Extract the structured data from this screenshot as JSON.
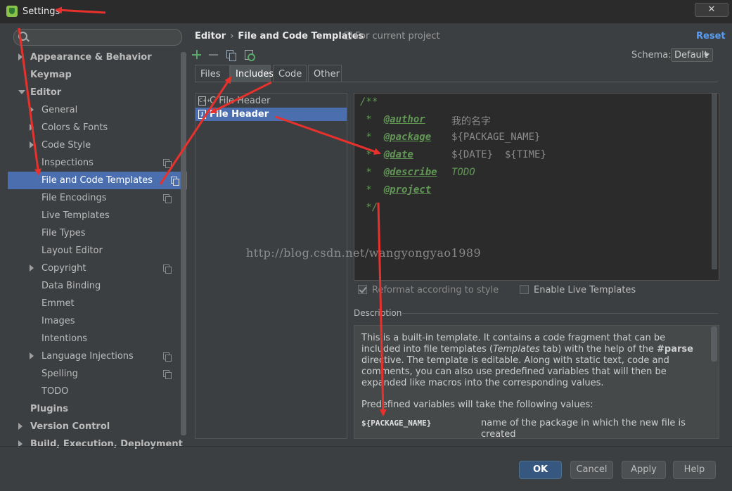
{
  "window": {
    "title": "Settings",
    "close_label": "✕"
  },
  "sidebar": {
    "search_placeholder": "",
    "items": [
      {
        "label": "Appearance & Behavior",
        "level": 0,
        "bold": true,
        "arrow": "right"
      },
      {
        "label": "Keymap",
        "level": 0,
        "bold": true
      },
      {
        "label": "Editor",
        "level": 0,
        "bold": true,
        "arrow": "down"
      },
      {
        "label": "General",
        "level": 1,
        "arrow": "right"
      },
      {
        "label": "Colors & Fonts",
        "level": 1,
        "arrow": "right"
      },
      {
        "label": "Code Style",
        "level": 1,
        "arrow": "right"
      },
      {
        "label": "Inspections",
        "level": 1,
        "copy": true
      },
      {
        "label": "File and Code Templates",
        "level": 1,
        "copy": true,
        "selected": true
      },
      {
        "label": "File Encodings",
        "level": 1,
        "copy": true
      },
      {
        "label": "Live Templates",
        "level": 1
      },
      {
        "label": "File Types",
        "level": 1
      },
      {
        "label": "Layout Editor",
        "level": 1
      },
      {
        "label": "Copyright",
        "level": 1,
        "arrow": "right",
        "copy": true
      },
      {
        "label": "Data Binding",
        "level": 1
      },
      {
        "label": "Emmet",
        "level": 1
      },
      {
        "label": "Images",
        "level": 1
      },
      {
        "label": "Intentions",
        "level": 1
      },
      {
        "label": "Language Injections",
        "level": 1,
        "arrow": "right",
        "copy": true
      },
      {
        "label": "Spelling",
        "level": 1,
        "copy": true
      },
      {
        "label": "TODO",
        "level": 1
      },
      {
        "label": "Plugins",
        "level": 0,
        "bold": true
      },
      {
        "label": "Version Control",
        "level": 0,
        "bold": true,
        "arrow": "right"
      },
      {
        "label": "Build, Execution, Deployment",
        "level": 0,
        "bold": true,
        "arrow": "right"
      }
    ]
  },
  "header": {
    "crumb_parent": "Editor",
    "crumb_sep": "›",
    "crumb_current": "File and Code Templates",
    "scope": "For current project",
    "reset_label": "Reset",
    "schema_label": "Schema:",
    "schema_value": "Default"
  },
  "tabs": [
    {
      "label": "Files",
      "active": false
    },
    {
      "label": "Includes",
      "active": true
    },
    {
      "label": "Code",
      "active": false
    },
    {
      "label": "Other",
      "active": false
    }
  ],
  "templates": [
    {
      "label": "C File Header",
      "icon": "C++",
      "selected": false
    },
    {
      "label": "File Header",
      "icon": "J",
      "selected": true
    }
  ],
  "editor": {
    "lines": [
      {
        "prefix": "/**",
        "tag": "",
        "value": ""
      },
      {
        "prefix": " *  ",
        "tag": "@author",
        "value": "我的名字"
      },
      {
        "prefix": " *  ",
        "tag": "@package",
        "value": "${PACKAGE_NAME}"
      },
      {
        "prefix": " *  ",
        "tag": "@date",
        "value": "${DATE}  ${TIME}"
      },
      {
        "prefix": " *  ",
        "tag": "@describe",
        "value": "TODO",
        "todo": true
      },
      {
        "prefix": " *  ",
        "tag": "@project",
        "value": ""
      },
      {
        "prefix": " */",
        "tag": "",
        "value": ""
      }
    ],
    "watermark": "http://blog.csdn.net/wangyongyao1989"
  },
  "options": {
    "reformat_label": "Reformat according to style",
    "reformat_checked": true,
    "live_label": "Enable Live Templates",
    "live_checked": false
  },
  "description": {
    "title": "Description",
    "p1_a": "This is a built-in template. It contains a code fragment that can be included into file templates (",
    "p1_em": "Templates",
    "p1_b": " tab) with the help of the ",
    "p1_strong": "#parse",
    "p1_c": " directive. The template is editable. Along with static text, code and comments, you can also use predefined variables that will then be expanded like macros into the corresponding values.",
    "note": "Predefined variables will take the following values:",
    "var_name": "${PACKAGE_NAME}",
    "var_desc": "name of the package in which the new file is created"
  },
  "buttons": {
    "ok": "OK",
    "cancel": "Cancel",
    "apply": "Apply",
    "help": "Help"
  },
  "colors": {
    "background": "#3c3f41",
    "selection": "#4b6eaf",
    "accent_link": "#589df6",
    "annotation": "#e8312c"
  }
}
